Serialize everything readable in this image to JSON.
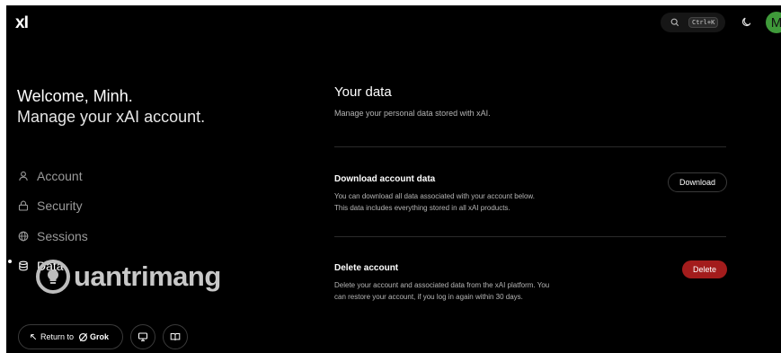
{
  "header": {
    "logo": "xI",
    "search_shortcut": "Ctrl+K",
    "avatar_initial": "M"
  },
  "sidebar": {
    "welcome": "Welcome, Minh.",
    "subtitle": "Manage your xAI account.",
    "items": [
      {
        "label": "Account",
        "icon": "user-icon"
      },
      {
        "label": "Security",
        "icon": "lock-icon"
      },
      {
        "label": "Sessions",
        "icon": "globe-icon"
      },
      {
        "label": "Data",
        "icon": "database-icon",
        "active": true
      }
    ],
    "return_label": "Return to",
    "grok_label": "Grok"
  },
  "watermark": {
    "text": "uantrimang"
  },
  "main": {
    "title": "Your data",
    "description": "Manage your personal data stored with xAI.",
    "download": {
      "title": "Download account data",
      "line1": "You can download all data associated with your account below.",
      "line2": "This data includes everything stored in all xAI products.",
      "button": "Download"
    },
    "delete": {
      "title": "Delete account",
      "line1": "Delete your account and associated data from the xAI platform. You",
      "line2": "can restore your account, if you log in again within 30 days.",
      "button": "Delete"
    }
  },
  "colors": {
    "background": "#000000",
    "danger": "#a31c1c",
    "avatar": "#3f9a3a"
  }
}
